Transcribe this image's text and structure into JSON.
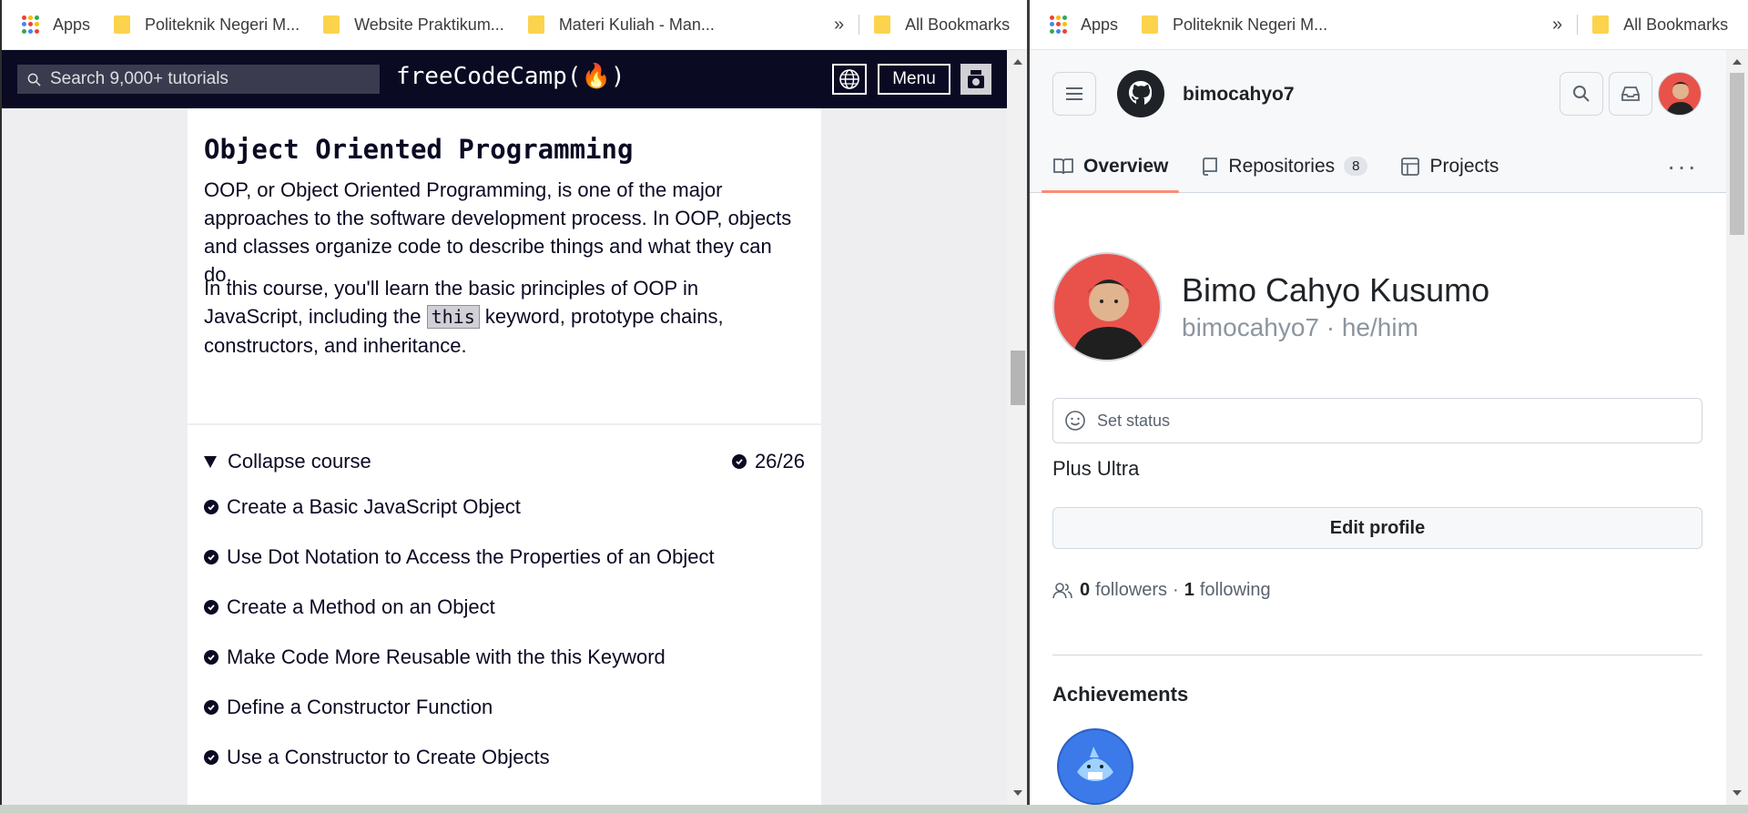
{
  "left_bookmarks": {
    "apps": "Apps",
    "items": [
      "Politeknik Negeri M...",
      "Website Praktikum...",
      "Materi Kuliah - Man..."
    ],
    "more": "»",
    "all": "All Bookmarks"
  },
  "right_bookmarks": {
    "apps": "Apps",
    "items": [
      "Politeknik Negeri M..."
    ],
    "more": "»",
    "all": "All Bookmarks"
  },
  "fcc": {
    "search_placeholder": "Search 9,000+ tutorials",
    "logo": "freeCodeCamp(🔥)",
    "menu_label": "Menu",
    "title": "Object Oriented Programming",
    "para1": "OOP, or Object Oriented Programming, is one of the major approaches to the software development process. In OOP, objects and classes organize code to describe things and what they can do.",
    "para2_before": "In this course, you'll learn the basic principles of OOP in JavaScript, including the ",
    "para2_code": "this",
    "para2_after": " keyword, prototype chains, constructors, and inheritance.",
    "collapse_label": "Collapse course",
    "progress": "26/26",
    "lessons": [
      "Create a Basic JavaScript Object",
      "Use Dot Notation to Access the Properties of an Object",
      "Create a Method on an Object",
      "Make Code More Reusable with the this Keyword",
      "Define a Constructor Function",
      "Use a Constructor to Create Objects"
    ]
  },
  "github": {
    "username": "bimocahyo7",
    "tabs": [
      {
        "label": "Overview",
        "icon": "book-icon",
        "active": true
      },
      {
        "label": "Repositories",
        "icon": "repo-icon",
        "count": "8"
      },
      {
        "label": "Projects",
        "icon": "table-icon"
      }
    ],
    "full_name": "Bimo Cahyo Kusumo",
    "handle": "bimocahyo7 · he/him",
    "status_placeholder": "Set status",
    "bio": "Plus Ultra",
    "edit_profile": "Edit profile",
    "followers_count": "0",
    "followers_label": "followers",
    "following_sep": "·",
    "following_count": "1",
    "following_label": "following",
    "achievements_title": "Achievements"
  },
  "colors": {
    "fcc_nav": "#0a0a23",
    "gh_active_tab": "#fd8c73",
    "avatar_bg": "#e9524a"
  }
}
